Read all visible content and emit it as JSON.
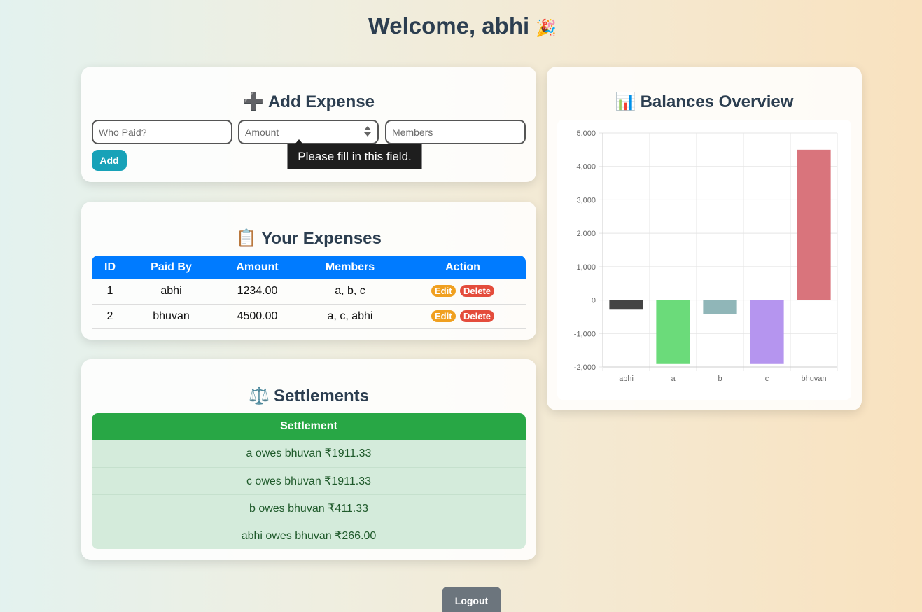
{
  "header": {
    "title": "Welcome, abhi",
    "emoji": "🎉"
  },
  "add_expense": {
    "title": "Add Expense",
    "emoji": "➕",
    "who_paid_placeholder": "Who Paid?",
    "amount_placeholder": "Amount",
    "members_placeholder": "Members",
    "add_label": "Add",
    "validation_tooltip": "Please fill in this field."
  },
  "expenses": {
    "title": "Your Expenses",
    "emoji": "📋",
    "columns": [
      "ID",
      "Paid By",
      "Amount",
      "Members",
      "Action"
    ],
    "rows": [
      {
        "id": "1",
        "paid_by": "abhi",
        "amount": "1234.00",
        "members": "a, b, c"
      },
      {
        "id": "2",
        "paid_by": "bhuvan",
        "amount": "4500.00",
        "members": "a, c, abhi"
      }
    ],
    "edit_label": "Edit",
    "delete_label": "Delete"
  },
  "settlements": {
    "title": "Settlements",
    "emoji": "⚖️",
    "header": "Settlement",
    "rows": [
      "a owes bhuvan ₹1911.33",
      "c owes bhuvan ₹1911.33",
      "b owes bhuvan ₹411.33",
      "abhi owes bhuvan ₹266.00"
    ]
  },
  "balances": {
    "title": "Balances Overview",
    "emoji": "📊"
  },
  "chart_data": {
    "type": "bar",
    "categories": [
      "abhi",
      "a",
      "b",
      "c",
      "bhuvan"
    ],
    "values": [
      -266.0,
      -1911.33,
      -411.33,
      -1911.33,
      4500.0
    ],
    "colors": [
      "#444444",
      "#6bdb7a",
      "#90b6b8",
      "#b595ef",
      "#d9747c"
    ],
    "ylim": [
      -2000,
      5000
    ],
    "yticks": [
      "5,000",
      "4,000",
      "3,000",
      "2,000",
      "1,000",
      "0",
      "-1,000",
      "-2,000"
    ],
    "ytick_values": [
      5000,
      4000,
      3000,
      2000,
      1000,
      0,
      -1000,
      -2000
    ],
    "grid": true
  },
  "logout_label": "Logout"
}
